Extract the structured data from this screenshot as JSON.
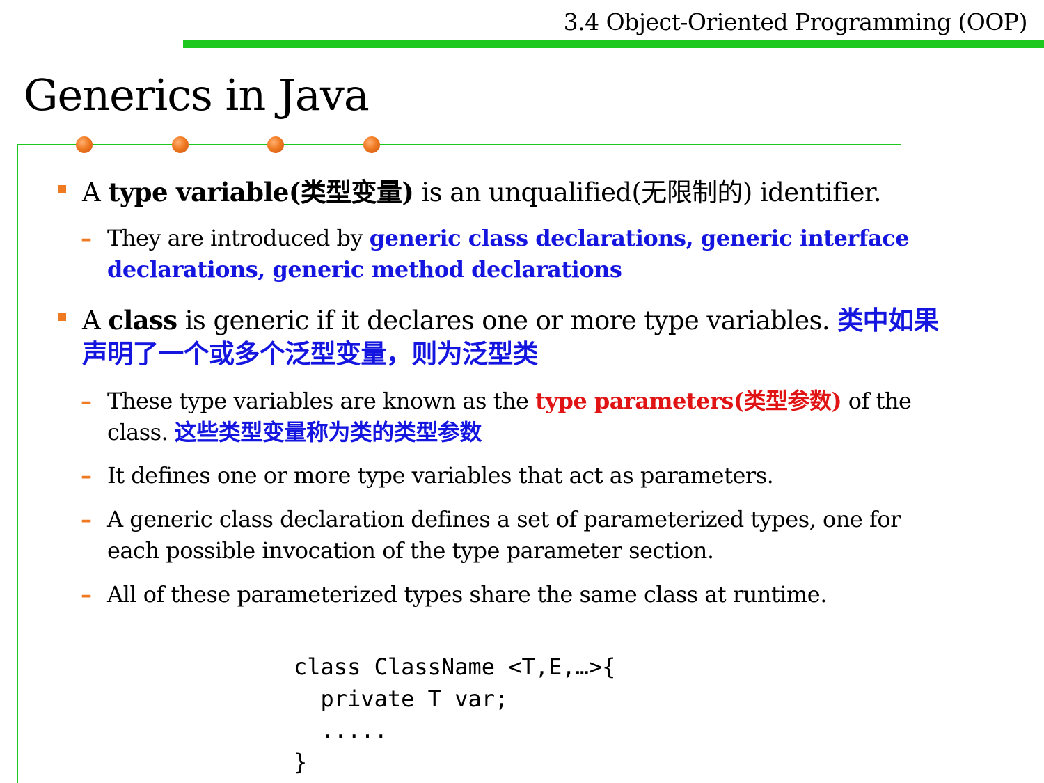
{
  "header": {
    "title": "3.4 Object-Oriented Programming (OOP)",
    "rule_color": "#1ec81e"
  },
  "slide": {
    "title": "Generics in Java"
  },
  "colors": {
    "accent_orange": "#f07a22",
    "highlight_blue": "#1515e0",
    "highlight_red": "#e01414"
  },
  "bullets": [
    {
      "p1": "A ",
      "b1": "type variable(类型变量)",
      "p2": " is an unqualified(无限制的) identifier.",
      "subs": [
        {
          "p1": "They are introduced by ",
          "blue": "generic class declarations, generic interface declarations, generic method declarations"
        }
      ]
    },
    {
      "p1": "A ",
      "b1": "class",
      "p2": " is generic if it declares one or more type variables. ",
      "cn": "类中如果声明了一个或多个泛型变量，则为泛型类",
      "subs": [
        {
          "p1": "These type variables are known as the ",
          "red": "type parameters(类型参数)",
          "p2": " of the class.  ",
          "cn": "这些类型变量称为类的类型参数"
        },
        {
          "text": "It defines one or more type variables that act as parameters."
        },
        {
          "text": "A generic class declaration defines a set of parameterized types, one for each possible invocation of the type parameter section."
        },
        {
          "text": "All of these parameterized types share the same class at runtime."
        }
      ]
    }
  ],
  "code": {
    "lines": [
      "class ClassName <T,E,…>{",
      "  private T var;",
      "  .....",
      "}"
    ]
  }
}
